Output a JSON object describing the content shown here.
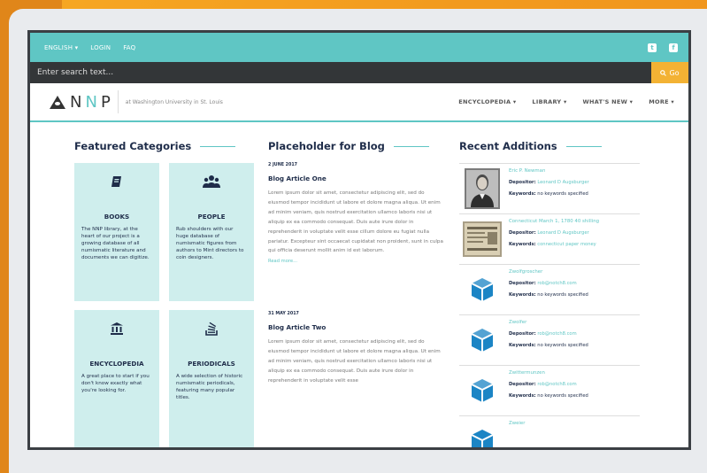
{
  "topbar": {
    "language": "ENGLISH ▾",
    "login": "LOGIN",
    "faq": "FAQ",
    "twitter_icon": "twitter-icon",
    "facebook_icon": "facebook-icon"
  },
  "search": {
    "placeholder": "Enter search text...",
    "go_label": "Go"
  },
  "header": {
    "logo_n1": "N",
    "logo_n2": "N",
    "logo_p": "P",
    "subtitle": "at Washington University in St. Louis",
    "nav": [
      "ENCYCLOPEDIA ▾",
      "LIBRARY ▾",
      "WHAT'S NEW ▾",
      "MORE ▾"
    ]
  },
  "featured": {
    "title": "Featured Categories",
    "items": [
      {
        "icon": "book-icon",
        "title": "BOOKS",
        "desc": "The NNP library, at the heart of our project is a growing database of all numismatic literature and documents we can digitize."
      },
      {
        "icon": "people-icon",
        "title": "PEOPLE",
        "desc": "Rub shoulders with our huge database of numismatic figures from authors to Mint directors to coin designers."
      },
      {
        "icon": "institution-icon",
        "title": "ENCYCLOPEDIA",
        "desc": "A great place to start if you don't know exactly what you're looking for."
      },
      {
        "icon": "stack-icon",
        "title": "PERIODICALS",
        "desc": "A wide selection of historic numismatic periodicals, featuring many popular titles."
      }
    ]
  },
  "blog": {
    "title": "Placeholder for Blog",
    "posts": [
      {
        "date": "2 JUNE 2017",
        "title": "Blog Article One",
        "body": "Lorem ipsum dolor sit amet, consectetur adipiscing elit, sed do eiusmod tempor incididunt ut labore et dolore magna aliqua. Ut enim ad minim veniam, quis nostrud exercitation ullamco laboris nisi ut aliquip ex ea commodo consequat. Duis aute irure dolor in reprehenderit in voluptate velit esse cillum dolore eu fugiat nulla pariatur. Excepteur sint occaecat cupidatat non proident, sunt in culpa qui officia deserunt mollit anim id est laborum.",
        "more": "Read more..."
      },
      {
        "date": "31 MAY 2017",
        "title": "Blog Article Two",
        "body": "Lorem ipsum dolor sit amet, consectetur adipiscing elit, sed do eiusmod tempor incididunt ut labore et dolore magna aliqua. Ut enim ad minim veniam, quis nostrud exercitation ullamco laboris nisi ut aliquip ex ea commodo consequat. Duis aute irure dolor in reprehenderit in voluptate velit esse"
      }
    ]
  },
  "recent": {
    "title": "Recent Additions",
    "depositor_label": "Depositor:",
    "keywords_label": "Keywords:",
    "items": [
      {
        "thumb": "portrait-photo",
        "name": "Eric P. Newman",
        "depositor": "Leonard D Augsburger",
        "keywords": "no keywords specified",
        "keywords_link": false
      },
      {
        "thumb": "paper-money-photo",
        "name": "Connecticut March 1, 1780 40 shilling",
        "depositor": "Leonard D Augsburger",
        "keywords": "connecticut paper money",
        "keywords_link": true
      },
      {
        "thumb": "box-icon",
        "name": "Zwolfgroscher",
        "depositor": "rob@notch8.com",
        "keywords": "no keywords specified",
        "keywords_link": false
      },
      {
        "thumb": "box-icon",
        "name": "Zwolfer",
        "depositor": "rob@notch8.com",
        "keywords": "no keywords specified",
        "keywords_link": false
      },
      {
        "thumb": "box-icon",
        "name": "Zwittermunzen",
        "depositor": "rob@notch8.com",
        "keywords": "no keywords specified",
        "keywords_link": false
      },
      {
        "thumb": "box-icon",
        "name": "Zweier"
      }
    ]
  },
  "colors": {
    "accent": "#5fc6c4",
    "navy": "#1f2d4a",
    "go": "#f3b234",
    "orange_bg": "#f19a1e"
  }
}
